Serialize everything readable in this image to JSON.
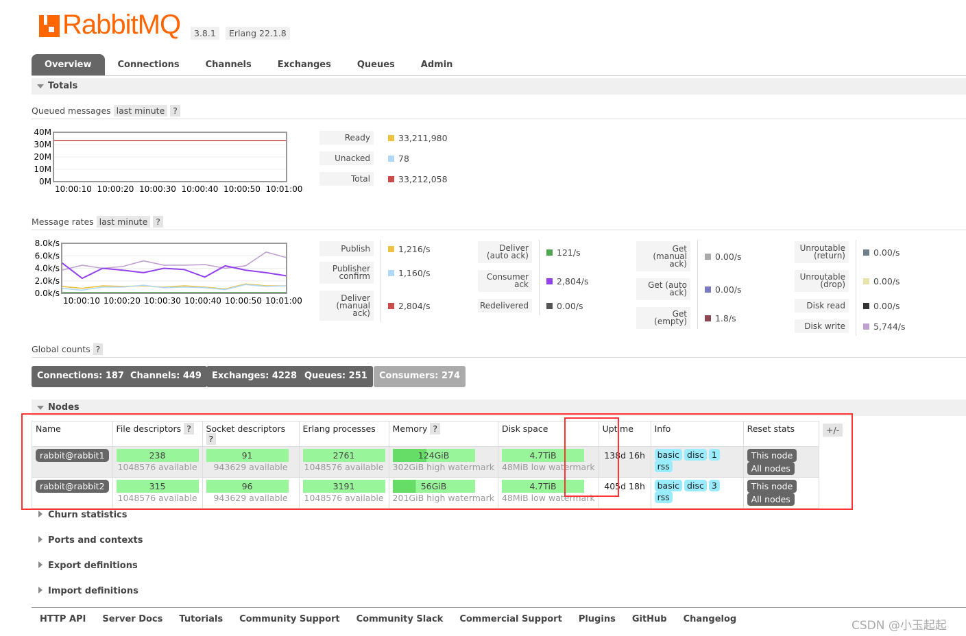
{
  "header": {
    "logo": "RabbitMQ",
    "version": "3.8.1",
    "erlang": "Erlang 22.1.8"
  },
  "tabs": [
    "Overview",
    "Connections",
    "Channels",
    "Exchanges",
    "Queues",
    "Admin"
  ],
  "totals": {
    "title": "Totals",
    "queued": {
      "label": "Queued messages",
      "range": "last minute",
      "help": "?",
      "items": [
        {
          "label": "Ready",
          "value": "33,211,980",
          "color": "#edc240"
        },
        {
          "label": "Unacked",
          "value": "78",
          "color": "#afd8f8"
        },
        {
          "label": "Total",
          "value": "33,212,058",
          "color": "#cb4b4b"
        }
      ]
    },
    "rates": {
      "label": "Message rates",
      "range": "last minute",
      "help": "?",
      "cols": [
        [
          {
            "label": "Publish",
            "value": "1,216/s",
            "color": "#edc240"
          },
          {
            "label": "Publisher confirm",
            "value": "1,160/s",
            "color": "#afd8f8"
          },
          {
            "label": "Deliver (manual ack)",
            "value": "2,804/s",
            "color": "#cb4b4b"
          }
        ],
        [
          {
            "label": "Deliver (auto ack)",
            "value": "121/s",
            "color": "#4da74d"
          },
          {
            "label": "Consumer ack",
            "value": "2,804/s",
            "color": "#9440ed"
          },
          {
            "label": "Redelivered",
            "value": "0.00/s",
            "color": "#555555"
          }
        ],
        [
          {
            "label": "Get (manual ack)",
            "value": "0.00/s",
            "color": "#aaaaaa"
          },
          {
            "label": "Get (auto ack)",
            "value": "0.00/s",
            "color": "#7c79c3"
          },
          {
            "label": "Get (empty)",
            "value": "1.8/s",
            "color": "#8d4653"
          }
        ],
        [
          {
            "label": "Unroutable (return)",
            "value": "0.00/s",
            "color": "#6f7f8c"
          },
          {
            "label": "Unroutable (drop)",
            "value": "0.00/s",
            "color": "#e8e3a8"
          },
          {
            "label": "Disk read",
            "value": "0.00/s",
            "color": "#333333"
          },
          {
            "label": "Disk write",
            "value": "5,744/s",
            "color": "#c0a0d0"
          }
        ]
      ]
    }
  },
  "chart_data": [
    {
      "type": "line",
      "x": [
        "10:00:10",
        "10:00:20",
        "10:00:30",
        "10:00:40",
        "10:00:50",
        "10:01:00"
      ],
      "yticks": [
        "40M",
        "30M",
        "20M",
        "10M",
        "0M"
      ],
      "ylim": [
        0,
        40000000
      ],
      "series": [
        {
          "name": "Total",
          "color": "#cb4b4b",
          "values": [
            33212058,
            33212058,
            33212058,
            33212058,
            33212058,
            33212058,
            33212058,
            33212058,
            33212058,
            33212058,
            33212058,
            33212058
          ]
        },
        {
          "name": "Unacked",
          "color": "#afd8f8",
          "values": [
            78,
            78,
            78,
            78,
            78,
            78,
            78,
            78,
            78,
            78,
            78,
            78
          ]
        }
      ]
    },
    {
      "type": "line",
      "x": [
        "10:00:10",
        "10:00:20",
        "10:00:30",
        "10:00:40",
        "10:00:50",
        "10:01:00"
      ],
      "yticks": [
        "8.0k/s",
        "6.0k/s",
        "4.0k/s",
        "2.0k/s",
        "0.0k/s"
      ],
      "ylim": [
        0,
        8000
      ],
      "series": [
        {
          "name": "Disk write",
          "color": "#c0a0d0",
          "values": [
            3700,
            4500,
            4000,
            4300,
            5200,
            4500,
            4500,
            4600,
            4000,
            4400,
            6600,
            5700
          ]
        },
        {
          "name": "Consumer ack",
          "color": "#9440ed",
          "values": [
            4900,
            2400,
            4000,
            3700,
            3300,
            4000,
            3800,
            2600,
            4400,
            3700,
            3300,
            2800
          ]
        },
        {
          "name": "Publish",
          "color": "#edc240",
          "values": [
            1100,
            800,
            1200,
            1100,
            1200,
            1000,
            1200,
            1000,
            700,
            1500,
            1200,
            1200
          ]
        },
        {
          "name": "Publisher confirm",
          "color": "#afd8f8",
          "values": [
            800,
            500,
            1000,
            1000,
            1300,
            900,
            1000,
            900,
            600,
            1400,
            1100,
            1200
          ]
        },
        {
          "name": "Deliver (auto ack)",
          "color": "#4da74d",
          "values": [
            120,
            120,
            120,
            120,
            120,
            120,
            120,
            120,
            120,
            120,
            120,
            120
          ]
        },
        {
          "name": "Redelivered",
          "color": "#555555",
          "values": [
            0,
            0,
            0,
            0,
            0,
            0,
            0,
            0,
            0,
            0,
            0,
            0
          ]
        }
      ]
    }
  ],
  "global": {
    "label": "Global counts",
    "help": "?",
    "counts": [
      "Connections: 187",
      "Channels: 449",
      "Exchanges: 4228",
      "Queues: 251",
      "Consumers: 274"
    ]
  },
  "nodes": {
    "title": "Nodes",
    "headers": [
      "Name",
      "File descriptors",
      "Socket descriptors",
      "Erlang processes",
      "Memory",
      "Disk space",
      "Uptime",
      "Info",
      "Reset stats"
    ],
    "help": "?",
    "plusminus": "+/-",
    "rows": [
      {
        "name": "rabbit@rabbit1",
        "fd": "238",
        "fd_avail": "1048576 available",
        "sd": "91",
        "sd_avail": "943629 available",
        "ep": "2761",
        "ep_avail": "1048576 available",
        "mem": "124GiB",
        "mem_wm": "302GiB high watermark",
        "mem_frac": 0.41,
        "disk": "4.7TiB",
        "disk_wm": "48MiB low watermark",
        "uptime": "138d 16h",
        "info": [
          "basic",
          "disc",
          "1",
          "rss"
        ],
        "reset": [
          "This node",
          "All nodes"
        ]
      },
      {
        "name": "rabbit@rabbit2",
        "fd": "315",
        "fd_avail": "1048576 available",
        "sd": "96",
        "sd_avail": "943629 available",
        "ep": "3191",
        "ep_avail": "1048576 available",
        "mem": "56GiB",
        "mem_wm": "201GiB high watermark",
        "mem_frac": 0.28,
        "disk": "4.7TiB",
        "disk_wm": "48MiB low watermark",
        "uptime": "405d 18h",
        "info": [
          "basic",
          "disc",
          "3",
          "rss"
        ],
        "reset": [
          "This node",
          "All nodes"
        ]
      }
    ]
  },
  "collapsed": [
    "Churn statistics",
    "Ports and contexts",
    "Export definitions",
    "Import definitions"
  ],
  "footer": [
    "HTTP API",
    "Server Docs",
    "Tutorials",
    "Community Support",
    "Community Slack",
    "Commercial Support",
    "Plugins",
    "GitHub",
    "Changelog"
  ],
  "watermark": "CSDN @小玉起起"
}
